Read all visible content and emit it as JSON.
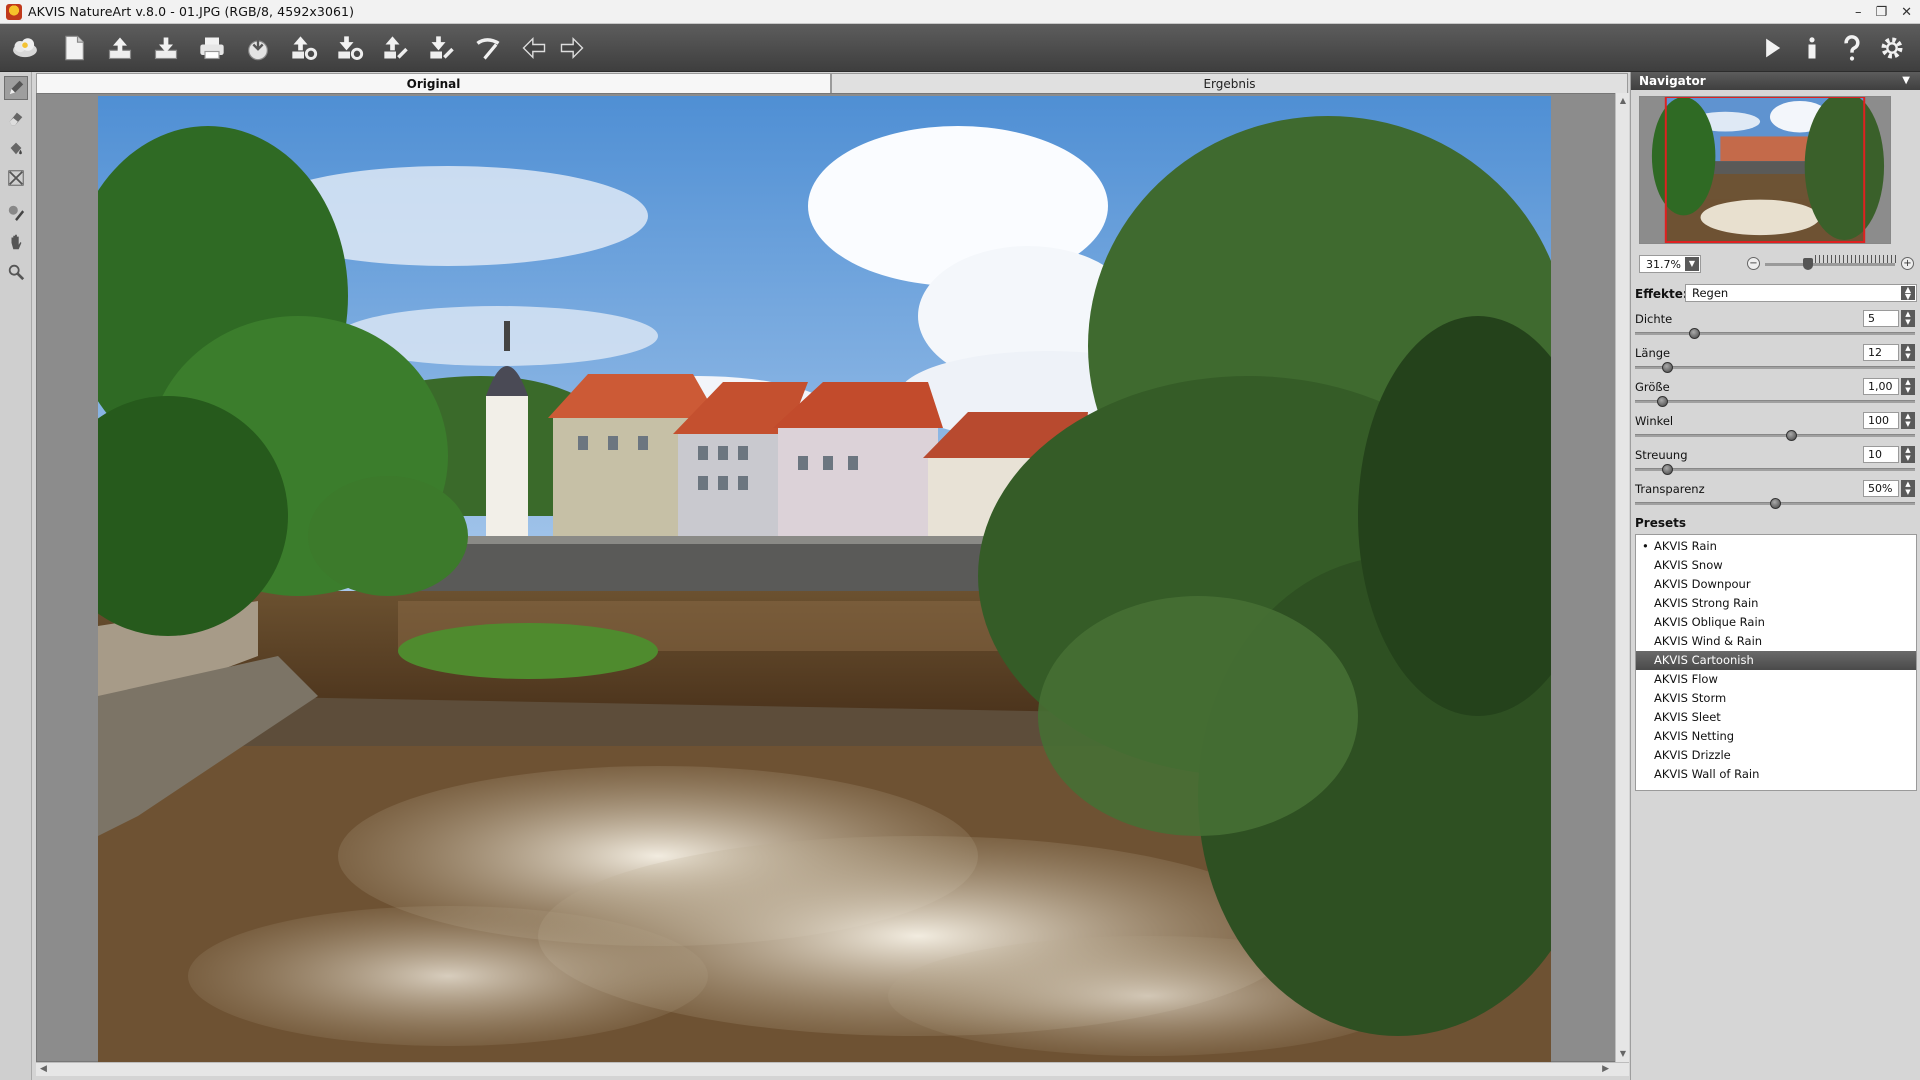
{
  "window": {
    "title": "AKVIS NatureArt v.8.0 - 01.JPG (RGB/8, 4592x3061)",
    "minimize": "–",
    "restore": "❐",
    "close": "✕"
  },
  "toolbar": {
    "left_icons": [
      "akvis-logo-icon",
      "new-document-icon",
      "open-file-icon",
      "save-file-icon",
      "print-icon",
      "import-icon",
      "batch-settings-icon",
      "export-settings-icon",
      "share-icon",
      "save-preset-icon",
      "brush-settings-icon",
      "undo-arrow-icon",
      "redo-arrow-icon"
    ],
    "right_icons": [
      "run-play-icon",
      "info-icon",
      "help-icon",
      "settings-gear-icon"
    ]
  },
  "tools": [
    "pencil-icon",
    "eraser-icon",
    "fill-bucket-icon",
    "crop-icon",
    "magic-brush-icon",
    "hand-icon",
    "zoom-icon"
  ],
  "tabs": {
    "original": "Original",
    "result": "Ergebnis"
  },
  "navigator": {
    "title": "Navigator",
    "zoom": "31.7%",
    "zoom_level": 0.32
  },
  "effects": {
    "label": "Effekte:",
    "value": "Regen"
  },
  "params": [
    {
      "label": "Dichte",
      "value": "5",
      "fraction": 0.2
    },
    {
      "label": "Länge",
      "value": "12",
      "fraction": 0.1
    },
    {
      "label": "Größe",
      "value": "1,00",
      "fraction": 0.08
    },
    {
      "label": "Winkel",
      "value": "100",
      "fraction": 0.56
    },
    {
      "label": "Streuung",
      "value": "10",
      "fraction": 0.1
    },
    {
      "label": "Transparenz",
      "value": "50%",
      "fraction": 0.5
    }
  ],
  "presets": {
    "title": "Presets",
    "items": [
      "AKVIS Rain",
      "AKVIS Snow",
      "AKVIS Downpour",
      "AKVIS Strong Rain",
      "AKVIS Oblique Rain",
      "AKVIS Wind & Rain",
      "AKVIS Cartoonish",
      "AKVIS Flow",
      "AKVIS Storm",
      "AKVIS Sleet",
      "AKVIS Netting",
      "AKVIS Drizzle",
      "AKVIS Wall of Rain"
    ],
    "current": 0,
    "selected": 6
  },
  "colors": {
    "toolbar": "#4a4a4a",
    "panel": "#d6d6d6",
    "selection": "#555555"
  }
}
